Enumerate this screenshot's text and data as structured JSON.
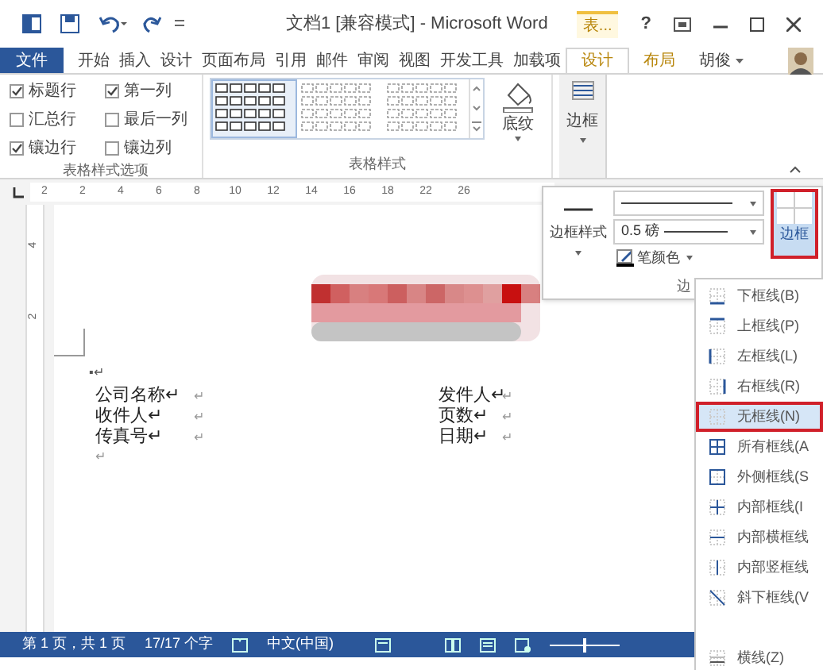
{
  "title_bar": {
    "title": "文档1 [兼容模式] - Microsoft Word",
    "context_tab": "表...",
    "help": "?"
  },
  "ribbon_tabs": [
    {
      "label": "文件",
      "kind": "file",
      "selected": false
    },
    {
      "label": "开始",
      "kind": "normal",
      "selected": false
    },
    {
      "label": "插入",
      "kind": "normal",
      "selected": false
    },
    {
      "label": "设计",
      "kind": "normal",
      "selected": false
    },
    {
      "label": "页面布局",
      "kind": "normal",
      "selected": false
    },
    {
      "label": "引用",
      "kind": "normal",
      "selected": false
    },
    {
      "label": "邮件",
      "kind": "normal",
      "selected": false
    },
    {
      "label": "审阅",
      "kind": "normal",
      "selected": false
    },
    {
      "label": "视图",
      "kind": "normal",
      "selected": false
    },
    {
      "label": "开发工具",
      "kind": "normal",
      "selected": false
    },
    {
      "label": "加载项",
      "kind": "normal",
      "selected": false
    },
    {
      "label": "设计",
      "kind": "context",
      "selected": true
    },
    {
      "label": "布局",
      "kind": "context",
      "selected": false
    }
  ],
  "account": {
    "name": "胡俊"
  },
  "style_options": {
    "group_label": "表格样式选项",
    "checkboxes": [
      {
        "label": "标题行",
        "checked": true
      },
      {
        "label": "第一列",
        "checked": true
      },
      {
        "label": "汇总行",
        "checked": false
      },
      {
        "label": "最后一列",
        "checked": false
      },
      {
        "label": "镶边行",
        "checked": true
      },
      {
        "label": "镶边列",
        "checked": false
      }
    ]
  },
  "table_styles": {
    "group_label": "表格样式",
    "styles": [
      {
        "selected": true
      },
      {
        "selected": false
      },
      {
        "selected": false
      }
    ],
    "shading_label": "底纹",
    "borders_label": "边框"
  },
  "ruler": {
    "numbers": [
      "2",
      "2",
      "4",
      "6",
      "8",
      "10",
      "12",
      "14",
      "16",
      "18",
      "22",
      "26"
    ],
    "vertical_numbers": [
      "4",
      "2"
    ]
  },
  "borders_panel": {
    "border_styles_label": "边框样式",
    "line_weight": "0.5 磅",
    "pen_color": "笔颜色",
    "borders_button": "边框",
    "group_label": "边"
  },
  "borders_menu": [
    {
      "label": "下框线(B)",
      "selected": false
    },
    {
      "label": "上框线(P)",
      "selected": false
    },
    {
      "label": "左框线(L)",
      "selected": false
    },
    {
      "label": "右框线(R)",
      "selected": false
    },
    {
      "label": "无框线(N)",
      "selected": true
    },
    {
      "label": "所有框线(A",
      "selected": false
    },
    {
      "label": "外侧框线(S",
      "selected": false
    },
    {
      "label": "内部框线(I",
      "selected": false
    },
    {
      "label": "内部横框线",
      "selected": false
    },
    {
      "label": "内部竖框线",
      "selected": false
    },
    {
      "label": "斜下框线(V",
      "selected": false
    },
    {
      "label": "横线(Z)",
      "selected": false
    }
  ],
  "document": {
    "bullet_line": "▪↵",
    "rows": [
      {
        "left": "公司名称↵",
        "left_end": "↵",
        "right": "发件人↵",
        "right_end": "↵"
      },
      {
        "left": "收件人↵",
        "left_end": "↵",
        "right": "页数↵",
        "right_end": "↵"
      },
      {
        "left": "传真号↵",
        "left_end": "↵",
        "right": "日期↵",
        "right_end": "↵"
      }
    ],
    "end_mark": "↵"
  },
  "status_bar": {
    "page": "第 1 页，共 1 页",
    "words": "17/17 个字",
    "language": "中文(中国)",
    "zoom": {
      "level": 0.5
    }
  }
}
